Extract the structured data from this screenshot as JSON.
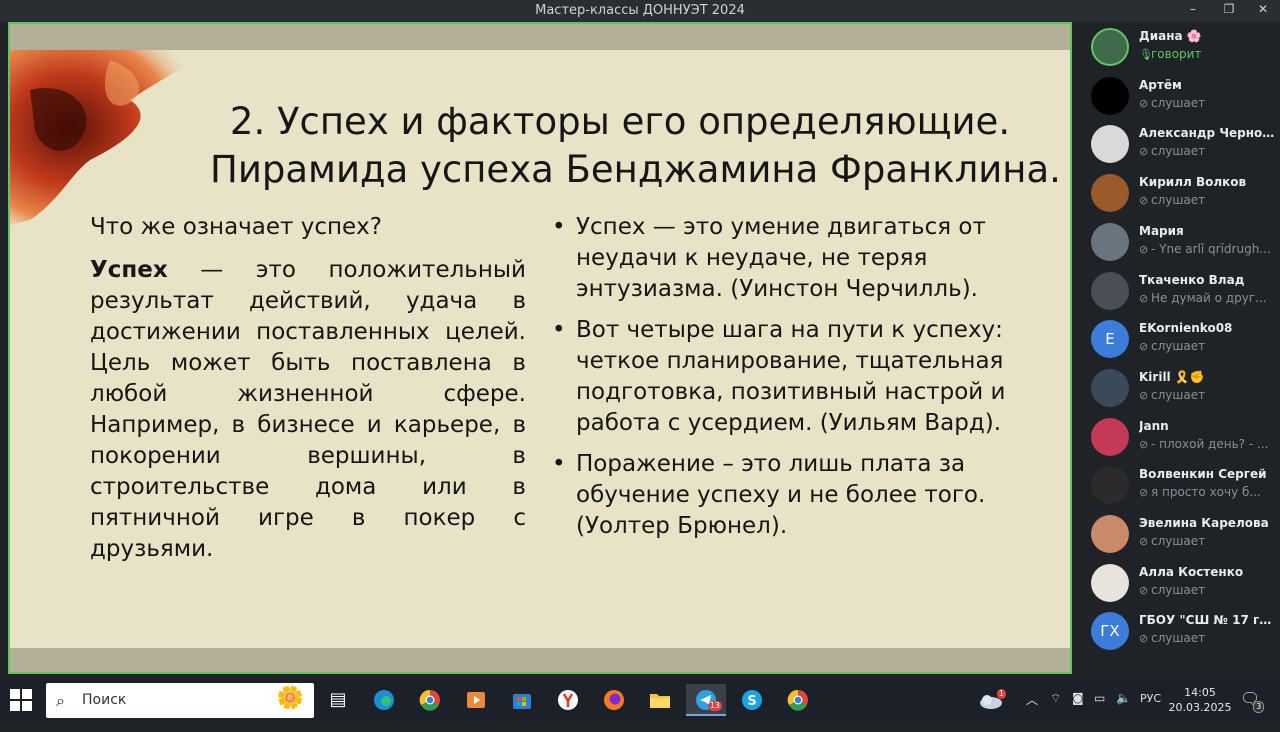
{
  "window": {
    "title": "Мастер-классы ДОННУЭТ 2024",
    "controls": [
      "–",
      "❐",
      "✕"
    ]
  },
  "slide": {
    "heading_line1": "2. Успех и факторы его определяющие.",
    "heading_line2": "Пирамида успеха Бенджамина Франклина.",
    "question": "Что же означает успех?",
    "definition_bold": "Успех",
    "definition_rest": " — это положительный результат действий, удача в достижении поставленных целей. Цель может быть поставлена в любой жизненной сфере. Например, в бизнесе и карьере, в покорении вершины, в строительстве дома или в пятничной игре в покер с друзьями.",
    "bullets": [
      "Успех — это умение двигаться от неудачи к неудаче, не теряя энтузиазма. (Уинстон Черчилль).",
      "Вот четыре шага на пути к успеху: четкое планирование, тщательная подготовка, позитивный настрой и работа с усердием. (Уильям Вард).",
      "Поражение – это лишь плата за обучение успеху и не более того. (Уолтер Брюнел)."
    ]
  },
  "participants": [
    {
      "name": "Диана 🌸",
      "status": "говорит",
      "speaking": true,
      "avatar_text": "",
      "avatar_color": "#3f6b4c"
    },
    {
      "name": "Артём",
      "status": "слушает",
      "speaking": false,
      "avatar_text": "",
      "avatar_color": "#000000"
    },
    {
      "name": "Александр Черно...",
      "status": "слушает",
      "speaking": false,
      "avatar_text": "",
      "avatar_color": "#d9d9d9"
    },
    {
      "name": "Кирилл Волков",
      "status": "слушает",
      "speaking": false,
      "avatar_text": "",
      "avatar_color": "#9a5a2a"
    },
    {
      "name": "Мария",
      "status": "- Yne arlī qrīdrugh...",
      "speaking": false,
      "avatar_text": "",
      "avatar_color": "#6b7580"
    },
    {
      "name": "Ткаченко Влад",
      "status": "Не думай о друг...",
      "speaking": false,
      "avatar_text": "",
      "avatar_color": "#4a4f55"
    },
    {
      "name": "EKornienko08",
      "status": "слушает",
      "speaking": false,
      "avatar_text": "E",
      "avatar_color": "#3b7dd8"
    },
    {
      "name": "Kirill 🎗️✊",
      "status": "слушает",
      "speaking": false,
      "avatar_text": "",
      "avatar_color": "#3a4a5a"
    },
    {
      "name": "Jann",
      "status": "- плохой день? - ...",
      "speaking": false,
      "avatar_text": "",
      "avatar_color": "#c23a55"
    },
    {
      "name": "Волвенкин Сергей",
      "status": "я просто хочу б...",
      "speaking": false,
      "avatar_text": "",
      "avatar_color": "#2b2b2b"
    },
    {
      "name": "Эвелина Карелова",
      "status": "слушает",
      "speaking": false,
      "avatar_text": "",
      "avatar_color": "#c98a6a"
    },
    {
      "name": "Алла Костенко",
      "status": "слушает",
      "speaking": false,
      "avatar_text": "",
      "avatar_color": "#e8e3dc"
    },
    {
      "name": "ГБОУ \"СШ № 17 г....",
      "status": "слушает",
      "speaking": false,
      "avatar_text": "ГХ",
      "avatar_color": "#3b7dd8"
    }
  ],
  "taskbar": {
    "search_placeholder": "Поиск",
    "telegram_badge": "13",
    "language": "РУС",
    "time": "14:05",
    "date": "20.03.2025",
    "notifications": "3",
    "weather_badge": "1"
  }
}
